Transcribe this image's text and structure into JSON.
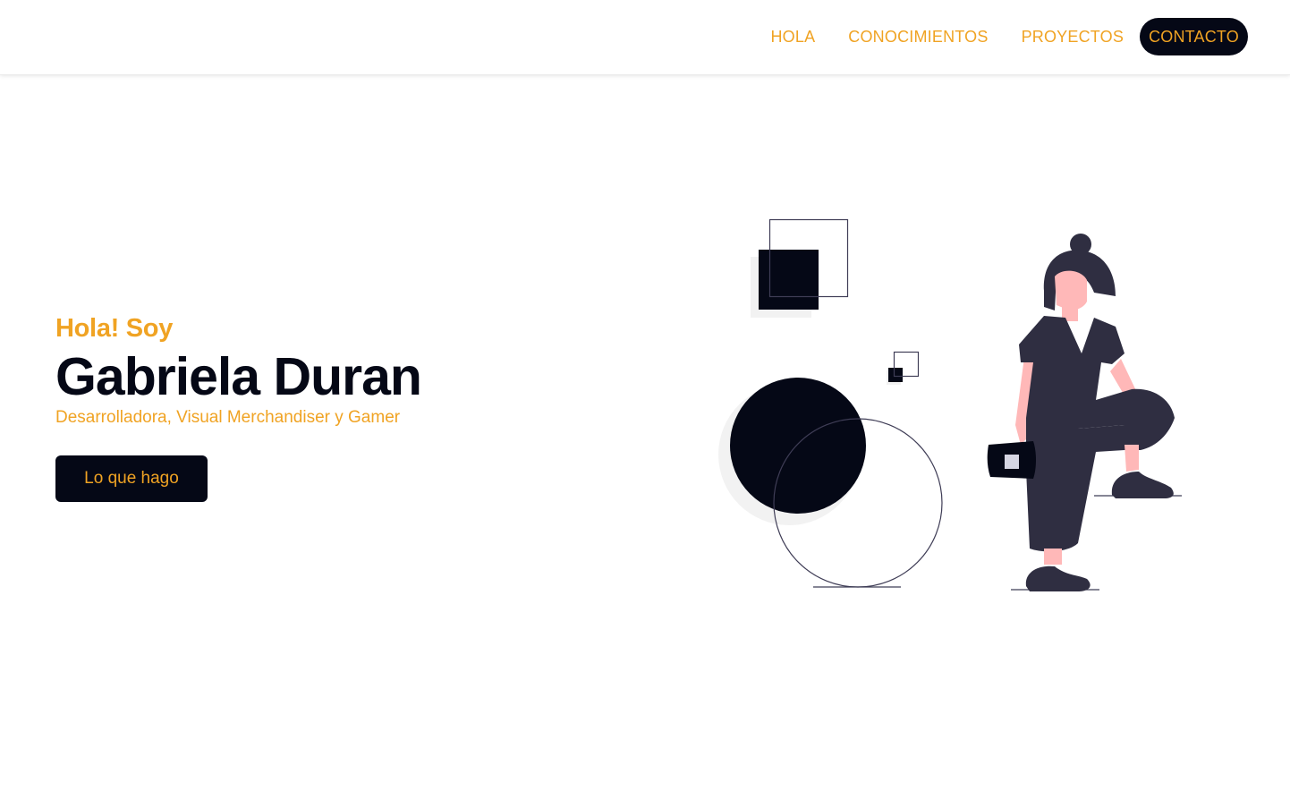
{
  "nav": {
    "items": [
      {
        "label": "HOLA"
      },
      {
        "label": "CONOCIMIENTOS"
      },
      {
        "label": "PROYECTOS"
      },
      {
        "label": "CONTACTO"
      }
    ]
  },
  "hero": {
    "greeting": "Hola! Soy",
    "name": "Gabriela Duran",
    "roles": "Desarrolladora, Visual Merchandiser y Gamer",
    "cta_label": "Lo que hago"
  },
  "colors": {
    "accent": "#f0a323",
    "dark": "#050816",
    "background": "#ffffff",
    "skin": "#ffb8b8",
    "outfit": "#2f2e41"
  },
  "illustration": {
    "icon": "woman-with-geometric-shapes-illustration"
  }
}
